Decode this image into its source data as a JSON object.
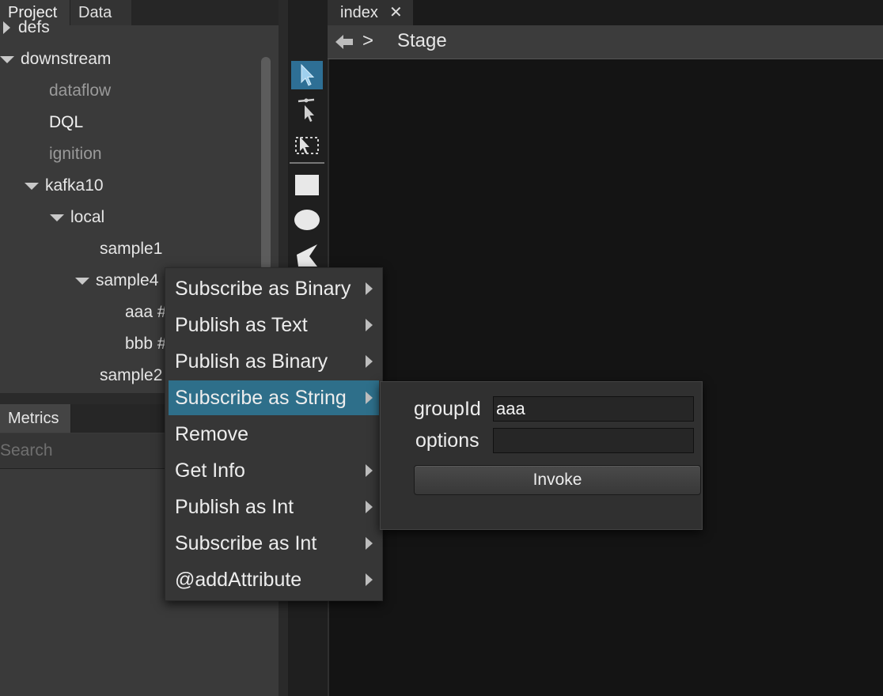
{
  "left_panel": {
    "tabs": [
      "Project",
      "Data"
    ],
    "tree": {
      "defs": "defs",
      "downstream": "downstream",
      "dataflow": "dataflow",
      "dql": "DQL",
      "ignition": "ignition",
      "kafka10": "kafka10",
      "local": "local",
      "sample1": "sample1",
      "sample4": "sample4",
      "aaa": "aaa #",
      "bbb": "bbb #",
      "sample2": "sample2"
    },
    "metrics_tab": "Metrics",
    "search_placeholder": "Search"
  },
  "toolbar": {
    "tools": [
      "select-arrow-icon",
      "pin-pointer-icon",
      "marquee-select-icon",
      "rectangle-icon",
      "ellipse-icon",
      "polygon-icon"
    ]
  },
  "editor": {
    "tab_label": "index",
    "tab_close": "✕",
    "breadcrumb_sep": ">",
    "breadcrumb_current": "Stage"
  },
  "context_menu": {
    "items": [
      {
        "label": "Subscribe as Binary"
      },
      {
        "label": "Publish as Text"
      },
      {
        "label": "Publish as Binary"
      },
      {
        "label": "Subscribe as String"
      },
      {
        "label": "Remove"
      },
      {
        "label": "Get Info"
      },
      {
        "label": "Publish as Int"
      },
      {
        "label": "Subscribe as Int"
      },
      {
        "label": "@addAttribute"
      }
    ]
  },
  "submenu": {
    "group_label": "groupId",
    "group_value": "aaa",
    "options_label": "options",
    "options_value": "",
    "invoke_label": "Invoke"
  },
  "colors": {
    "selection": "#2e6f8a",
    "tool_selected": "#2e6f95",
    "stage_background": "#141414"
  }
}
